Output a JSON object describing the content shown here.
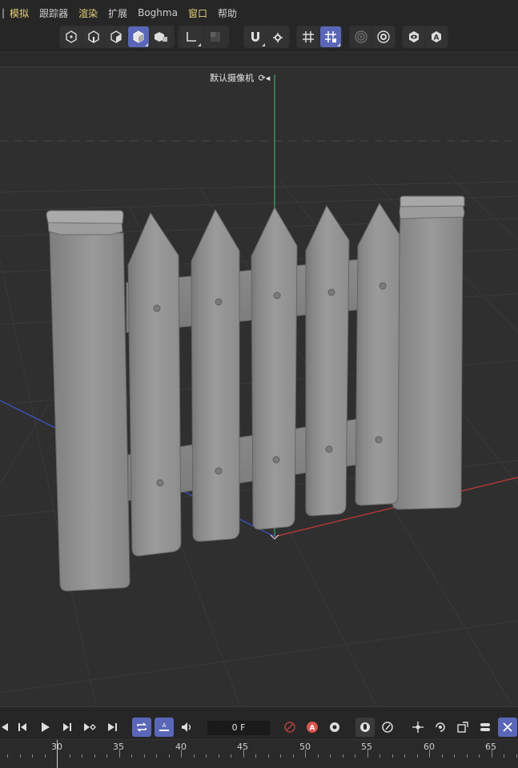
{
  "menu": {
    "items": [
      "模拟",
      "跟踪器",
      "渲染",
      "扩展",
      "Boghma",
      "窗口",
      "帮助"
    ],
    "highlighted": [
      "模拟",
      "渲染",
      "窗口"
    ]
  },
  "toolbar": {
    "icons": [
      "points-mode-icon",
      "edges-mode-icon",
      "polygons-mode-icon",
      "model-mode-icon",
      "texture-mode-icon",
      "axis-icon",
      "workplane-icon",
      "snap-magnet-icon",
      "snap-settings-icon",
      "grid-icon",
      "workplane-grid-icon",
      "soft-selection-icon",
      "modeling-settings-icon",
      "viewport-solo-icon",
      "attribute-icon"
    ]
  },
  "viewport": {
    "camera_label": "默认摄像机",
    "camera_icon": "camera-cycle-icon",
    "colors": {
      "y_axis": "#37c27a",
      "x_axis": "#c83a3a",
      "z_axis": "#3a5ad0",
      "grid": "#3b3b3b",
      "bg": "#2f2f2f"
    }
  },
  "timeline": {
    "current_frame": "0 F",
    "ruler_labels": [
      "30",
      "35",
      "40",
      "45",
      "50",
      "55",
      "60",
      "65"
    ],
    "accent": "#5a67b8",
    "record_color": "#d9534f"
  }
}
